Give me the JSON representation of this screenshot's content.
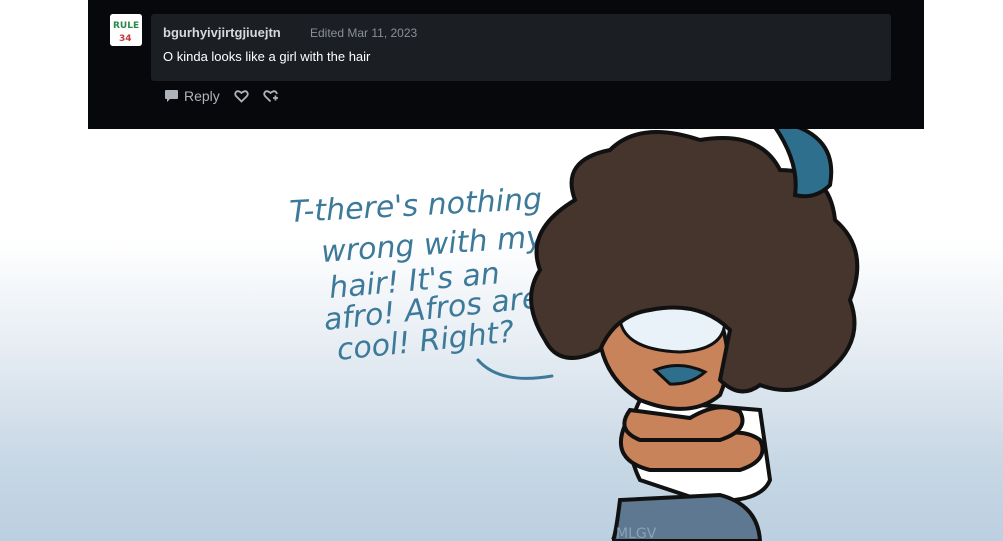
{
  "comment": {
    "username": "bgurhyivjirtgjiuejtn",
    "edited": "Edited Mar 11, 2023",
    "text": "O kinda looks like a girl with the hair",
    "avatar_lines": [
      "RULE",
      "34"
    ]
  },
  "actions": {
    "reply_label": "Reply",
    "icons": [
      "speech-bubble-icon",
      "heart-icon",
      "reblog-heart-icon"
    ]
  },
  "artwork": {
    "speech_lines": [
      "T-there's nothing",
      "wrong with my",
      "hair! It's an",
      "afro! Afros are",
      "cool! Right?"
    ],
    "signature": "MLGV"
  },
  "colors": {
    "panel_bg": "#06080b",
    "bubble_bg": "#1b1e23",
    "text_blue": "#3d7a9a",
    "hair": "#46352d",
    "skin": "#c8835a",
    "hair_tip": "#2e6f8e"
  }
}
